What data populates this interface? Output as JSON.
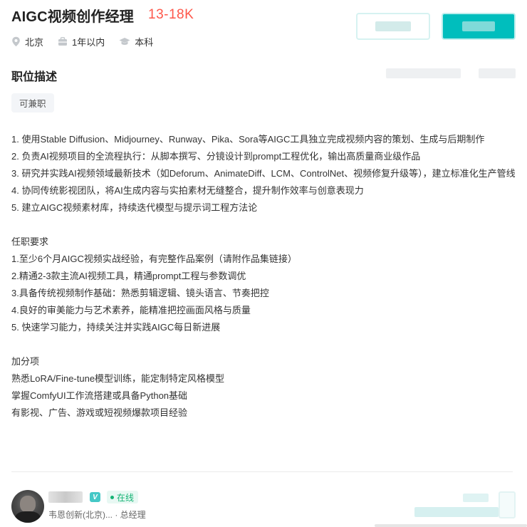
{
  "job": {
    "title": "AIGC视频创作经理",
    "salary": "13-18K"
  },
  "meta": {
    "city": "北京",
    "experience": "1年以内",
    "education": "本科",
    "icons": [
      "location-icon",
      "briefcase-icon",
      "graduation-cap-icon"
    ]
  },
  "section": {
    "title": "职位描述",
    "tag": "可兼职"
  },
  "description": {
    "duties": [
      "1. 使用Stable Diffusion、Midjourney、Runway、Pika、Sora等AIGC工具独立完成视频内容的策划、生成与后期制作",
      "2. 负责AI视频项目的全流程执行：从脚本撰写、分镜设计到prompt工程优化，输出高质量商业级作品",
      "3. 研究并实践AI视频领域最新技术（如Deforum、AnimateDiff、LCM、ControlNet、视频修复升级等），建立标准化生产管线",
      "4. 协同传统影视团队，将AI生成内容与实拍素材无缝整合，提升制作效率与创意表现力",
      "5. 建立AIGC视频素材库，持续迭代模型与提示词工程方法论"
    ],
    "requirements_title": "任职要求",
    "requirements": [
      "1.至少6个月AIGC视频实战经验，有完整作品案例（请附作品集链接）",
      "2.精通2-3款主流AI视频工具，精通prompt工程与参数调优",
      "3.具备传统视频制作基础：熟悉剪辑逻辑、镜头语言、节奏把控",
      "4.良好的审美能力与艺术素养，能精准把控画面风格与质量",
      "5. 快速学习能力，持续关注并实践AIGC每日新进展"
    ],
    "bonus_title": "加分项",
    "bonus": [
      "熟悉LoRA/Fine-tune模型训练，能定制特定风格模型",
      "掌握ComfyUI工作流搭建或具备Python基础",
      "有影视、广告、游戏或短视频爆款项目经验"
    ]
  },
  "recruiter": {
    "verified_badge": "V",
    "status": "在线",
    "company_title": "韦恩创新(北京)... · 总经理"
  },
  "colors": {
    "salary": "#fe574a",
    "brand": "#00bebd",
    "online": "#15b374"
  }
}
